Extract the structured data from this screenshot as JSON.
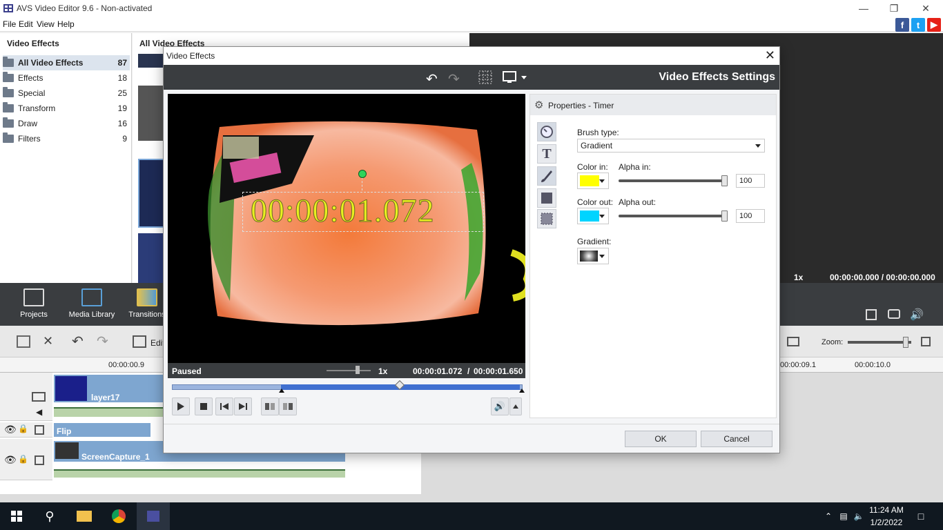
{
  "app": {
    "title": "AVS Video Editor 9.6 - Non-activated",
    "menu": [
      "File",
      "Edit",
      "View",
      "Help"
    ]
  },
  "left_panel": {
    "header": "Video Effects",
    "categories": [
      {
        "label": "All Video Effects",
        "count": "87"
      },
      {
        "label": "Effects",
        "count": "18"
      },
      {
        "label": "Special",
        "count": "25"
      },
      {
        "label": "Transform",
        "count": "19"
      },
      {
        "label": "Draw",
        "count": "16"
      },
      {
        "label": "Filters",
        "count": "9"
      }
    ]
  },
  "effects_strip": {
    "header": "All Video Effects"
  },
  "toolbar_tabs": [
    {
      "label": "Projects"
    },
    {
      "label": "Media Library"
    },
    {
      "label": "Transitions"
    }
  ],
  "right_preview": {
    "speed": "1x",
    "time": "00:00:00.000 / 00:00:00.000"
  },
  "timeline": {
    "edit_label": "Edit",
    "zoom_label": "Zoom:",
    "ruler": [
      "00:00:00.9",
      "00:00:09.1",
      "00:00:10.0"
    ],
    "clips": {
      "layer": "layer17",
      "effect": "Flip",
      "capture": "ScreenCapture_1"
    }
  },
  "taskbar": {
    "time": "11:24 AM",
    "date": "1/2/2022"
  },
  "dialog": {
    "title": "Video Effects",
    "header_title": "Video Effects Settings",
    "timer_text": "00:00:01.072",
    "status": "Paused",
    "speed": "1x",
    "time_current": "00:00:01.072",
    "time_separator": "/",
    "time_total": "00:00:01.650",
    "seek_position": 0.65,
    "properties": {
      "header": "Properties - Timer",
      "brush_type_label": "Brush type:",
      "brush_type_value": "Gradient",
      "color_in_label": "Color in:",
      "color_in": "#ffff00",
      "alpha_in_label": "Alpha in:",
      "alpha_in": "100",
      "color_out_label": "Color out:",
      "color_out": "#00d4ff",
      "alpha_out_label": "Alpha out:",
      "alpha_out": "100",
      "gradient_label": "Gradient:"
    },
    "ok_label": "OK",
    "cancel_label": "Cancel"
  }
}
